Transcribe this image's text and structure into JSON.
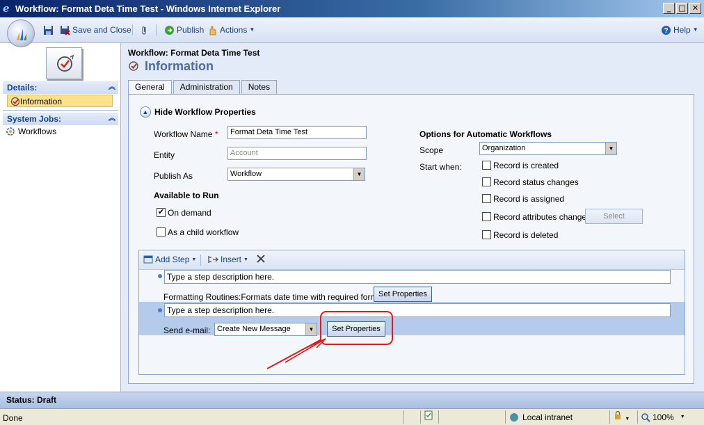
{
  "window": {
    "title": "Workflow: Format Deta Time Test - Windows Internet Explorer"
  },
  "toolbar": {
    "save_label": "Save and Close",
    "publish_label": "Publish",
    "actions_label": "Actions",
    "help_label": "Help"
  },
  "sidebar": {
    "details_header": "Details:",
    "details_items": [
      {
        "label": "Information"
      }
    ],
    "jobs_header": "System Jobs:",
    "jobs_items": [
      {
        "label": "Workflows"
      }
    ]
  },
  "main": {
    "workflow_title": "Workflow: Format Deta Time Test",
    "section_title": "Information",
    "tabs": [
      {
        "label": "General"
      },
      {
        "label": "Administration"
      },
      {
        "label": "Notes"
      }
    ],
    "hide_props_label": "Hide Workflow Properties",
    "fields": {
      "name_label": "Workflow Name",
      "name_required": "*",
      "name_value": "Format Deta Time Test",
      "entity_label": "Entity",
      "entity_value": "Account",
      "publish_as_label": "Publish As",
      "publish_as_value": "Workflow"
    },
    "available": {
      "title": "Available to Run",
      "on_demand": "On demand",
      "child_workflow": "As a child workflow"
    },
    "options": {
      "title": "Options for Automatic Workflows",
      "scope_label": "Scope",
      "scope_value": "Organization",
      "start_when_label": "Start when:",
      "triggers": [
        {
          "label": "Record is created"
        },
        {
          "label": "Record status changes"
        },
        {
          "label": "Record is assigned"
        },
        {
          "label": "Record attributes change"
        },
        {
          "label": "Record is deleted"
        }
      ],
      "select_label": "Select"
    },
    "steps": {
      "add_step_label": "Add Step",
      "insert_label": "Insert",
      "placeholder1": "Type a step description here.",
      "step1_label": "Formatting Routines:Formats date time with required format",
      "set_props_label": "Set Properties",
      "placeholder2": "Type a step description here.",
      "step2_label": "Send e-mail:",
      "step2_select": "Create New Message"
    }
  },
  "status": {
    "label": "Status: Draft"
  },
  "ie_status": {
    "done": "Done",
    "zone": "Local intranet",
    "zoom": "100%"
  },
  "colors": {
    "accent": "#15428b",
    "annotation": "#e11b1b"
  }
}
